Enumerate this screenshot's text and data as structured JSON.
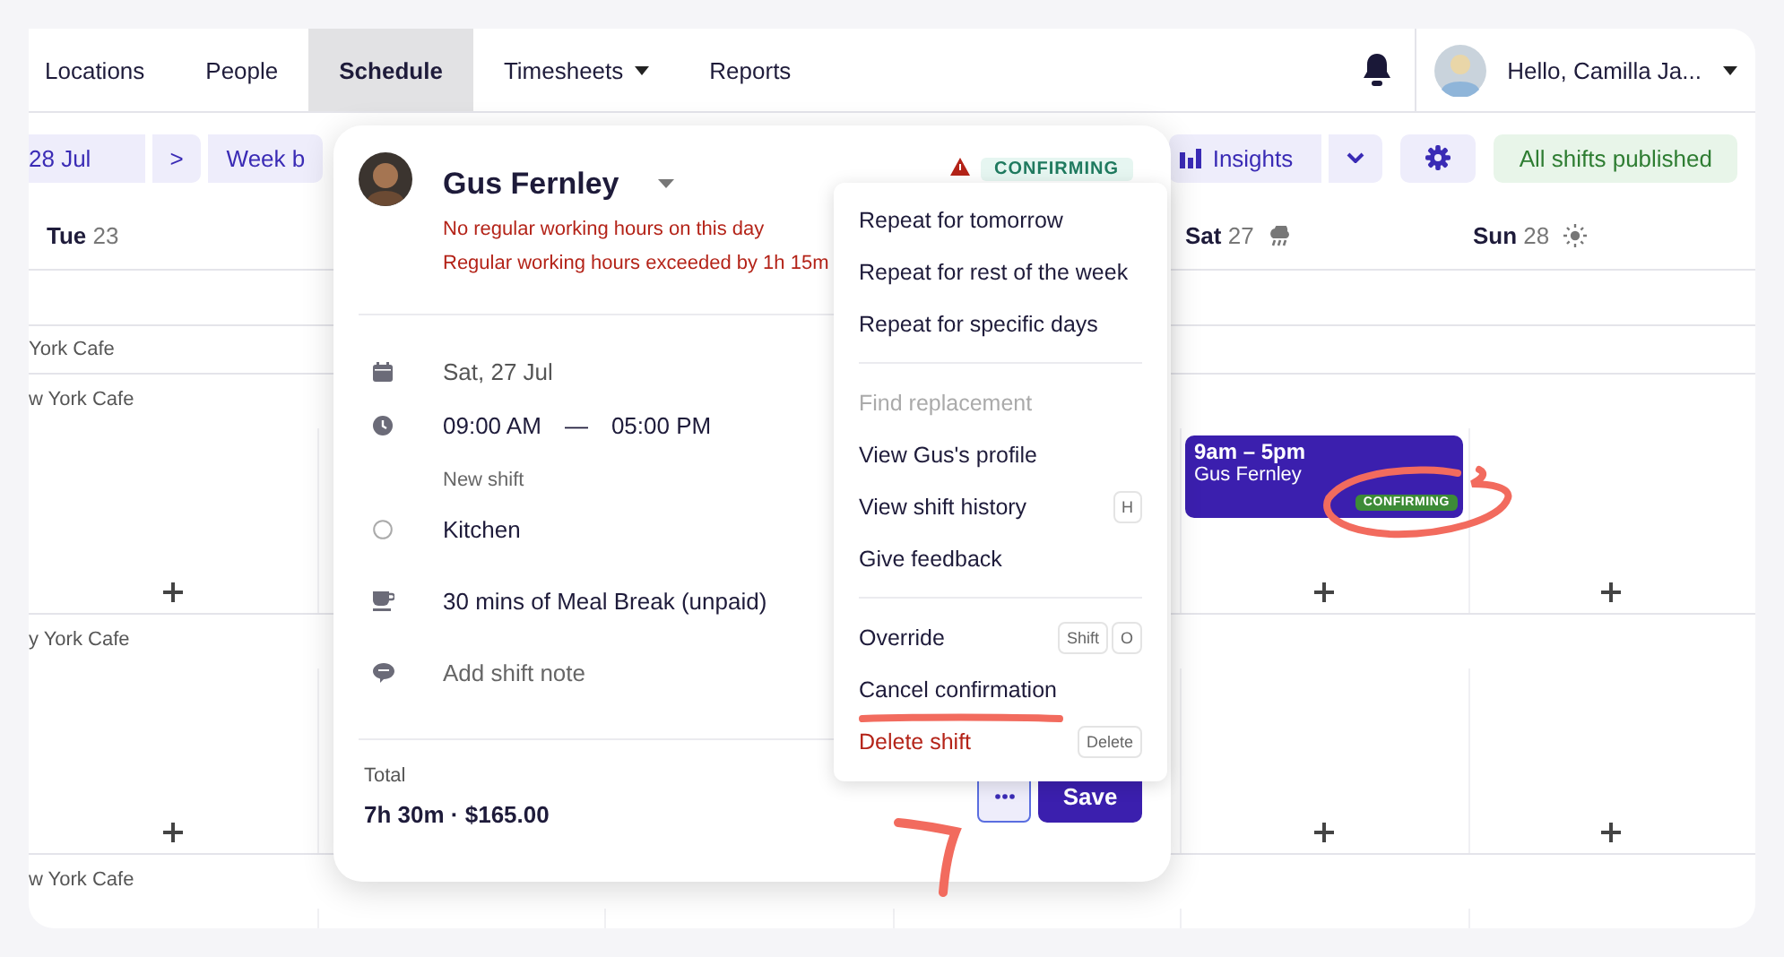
{
  "nav": {
    "tabs": [
      {
        "label": "Locations",
        "selected": false,
        "dropdown": false
      },
      {
        "label": "People",
        "selected": false,
        "dropdown": false
      },
      {
        "label": "Schedule",
        "selected": true,
        "dropdown": false
      },
      {
        "label": "Timesheets",
        "selected": false,
        "dropdown": true
      },
      {
        "label": "Reports",
        "selected": false,
        "dropdown": false
      }
    ],
    "greeting": "Hello, Camilla Ja..."
  },
  "toolbar": {
    "date_range": "28 Jul",
    "next": ">",
    "view": "Week b",
    "insights": "Insights",
    "status": "All shifts published"
  },
  "days": [
    {
      "weekday": "Tue",
      "date": "23",
      "kind": "plain"
    },
    {
      "weekday": "Sat",
      "date": "27",
      "kind": "cloud"
    },
    {
      "weekday": "Sun",
      "date": "28",
      "kind": "sun"
    }
  ],
  "location_band": "York Cafe",
  "rows": [
    {
      "location": "w York Cafe",
      "shift": {
        "time": "9am – 5pm",
        "name": "Gus Fernley",
        "badge": "CONFIRMING"
      }
    },
    {
      "location": "y York Cafe"
    },
    {
      "location": "w York Cafe"
    }
  ],
  "popover": {
    "name": "Gus Fernley",
    "warnings": [
      "No regular working hours on this day",
      "Regular working hours exceeded by 1h 15m"
    ],
    "status": "CONFIRMING",
    "details": [
      {
        "kind": "date",
        "text": "Sat, 27 Jul"
      },
      {
        "kind": "time",
        "start": "09:00 AM",
        "separator": "—",
        "end": "05:00 PM",
        "sub": "New shift"
      },
      {
        "kind": "area",
        "text": "Kitchen"
      },
      {
        "kind": "break",
        "text": "30 mins of Meal Break (unpaid)"
      },
      {
        "kind": "note",
        "placeholder": "Add shift note"
      }
    ],
    "total_label": "Total",
    "total": "7h 30m · $165.00",
    "save": "Save"
  },
  "menu": [
    [
      {
        "label": "Repeat for tomorrow",
        "disabled": false,
        "kind": "normal"
      },
      {
        "label": "Repeat for rest of the week",
        "disabled": false,
        "kind": "normal"
      },
      {
        "label": "Repeat for specific days",
        "disabled": false,
        "kind": "normal"
      }
    ],
    [
      {
        "label": "Find replacement",
        "disabled": true,
        "kind": "normal"
      },
      {
        "label": "View Gus's profile",
        "disabled": false,
        "kind": "normal"
      },
      {
        "label": "View shift history",
        "disabled": false,
        "kind": "normal",
        "keys": [
          "H"
        ]
      },
      {
        "label": "Give feedback",
        "disabled": false,
        "kind": "normal"
      }
    ],
    [
      {
        "label": "Override",
        "disabled": false,
        "kind": "normal",
        "keys": [
          "Shift",
          "O"
        ]
      },
      {
        "label": "Cancel confirmation",
        "disabled": false,
        "kind": "normal"
      },
      {
        "label": "Delete shift",
        "disabled": false,
        "kind": "danger",
        "keys": [
          "Delete"
        ]
      }
    ]
  ]
}
